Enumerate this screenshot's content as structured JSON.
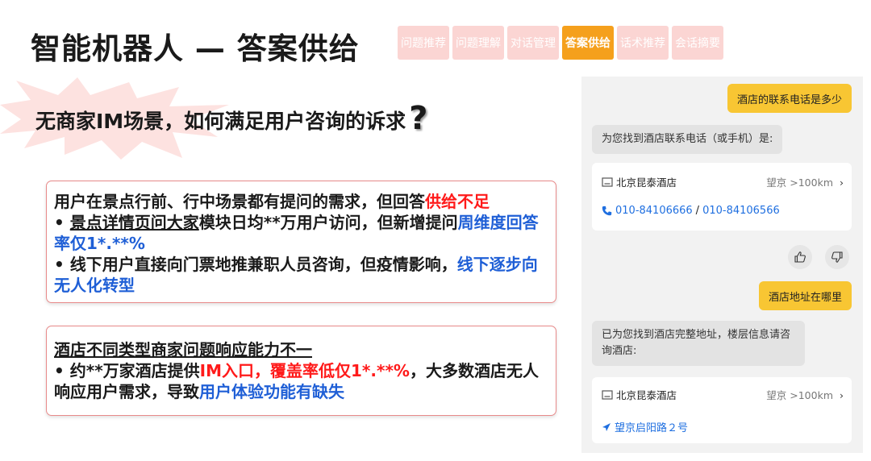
{
  "slide": {
    "title": "智能机器人 — 答案供给",
    "tabs": [
      {
        "label": "问题推荐",
        "active": false
      },
      {
        "label": "问题理解",
        "active": false
      },
      {
        "label": "对话管理",
        "active": false
      },
      {
        "label": "答案供给",
        "active": true
      },
      {
        "label": "话术推荐",
        "active": false
      },
      {
        "label": "会话摘要",
        "active": false
      }
    ],
    "question": "无商家IM场景，如何满足用户咨询的诉求",
    "box1": {
      "line1_a": "用户在景点行前、行中场景都有提问的需求，但回答",
      "line1_b": "供给不足",
      "b1_prefix": "• ",
      "b1_a": "景点详情页问大家",
      "b1_b": "模块日均**万用户访问，但新增提问",
      "b1_c": "周维度回答率仅1*.**%",
      "b2_a": "• 线下用户直接向门票地推兼职人员咨询，但疫情影响，",
      "b2_b": "线下逐步向无人化转型"
    },
    "box2": {
      "heading": "酒店不同类型商家问题响应能力不一",
      "b1_a": "• 约**万家酒店提供",
      "b1_b": "IM入口，覆盖率低仅1*.**%",
      "b1_c": "，大多数酒店无人响应用户需求，导致",
      "b1_d": "用户体验功能有缺失"
    }
  },
  "chat": {
    "msg1_user": "酒店的联系电话是多少",
    "msg2_bot": "为您找到酒店联系电话（或手机）是:",
    "card1": {
      "hotel": "北京昆泰酒店",
      "meta": "望京  >100km",
      "phone_a": "010-84106666",
      "separator": " / ",
      "phone_b": "010-84106566"
    },
    "msg3_user": "酒店地址在哪里",
    "msg4_bot": "已为您找到酒店完整地址，楼层信息请咨询酒店:",
    "card2": {
      "hotel": "北京昆泰酒店",
      "meta": "望京  >100km",
      "address": "望京启阳路２号"
    }
  },
  "colors": {
    "tab_inactive": "#fbd5d3",
    "tab_active": "#f5a01c",
    "red_text": "#ff1a1a",
    "blue_text": "#1f5fd6",
    "user_bubble": "#f8c633",
    "link_blue": "#1f6fe0"
  }
}
